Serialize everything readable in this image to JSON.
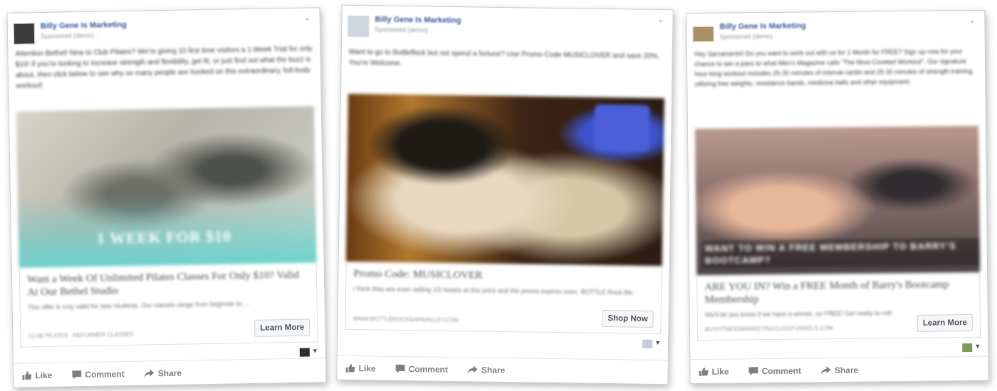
{
  "posts": [
    {
      "page_name": "Billy Gene Is Marketing",
      "sponsored": "Sponsored (demo) · ",
      "text": "Attention Bethel! New to Club Pilates? We're giving 10 first time visitors a 1-Week Trial for only $10! If you're looking to increase strength and flexibility, get fit, or just find out what the buzz is about, then click below to see why so many people are hooked on this extraordinary, full-body workout!",
      "image_overlay": "1 WEEK FOR $10",
      "headline": "Want a Week Of Unlimited Pilates Classes For Only $10? Valid At Our Bethel Studio",
      "description": "This offer is only valid for new students. Our classes range from beginner to ...",
      "url": "CLUB PILATES · REFORMER CLASSES",
      "cta": "Learn More"
    },
    {
      "page_name": "Billy Gene Is Marketing",
      "sponsored": "Sponsored (demo) · ",
      "text": "Want to go to Bottleflock but not spend a fortune? Use Promo Code MUSICLOVER and save 20%. You're Welcome.",
      "image_overlay": "",
      "headline": "Promo Code: MUSICLOVER",
      "description": "I think they are even selling 1/2 tickets at this price and the promo expires soon. BOTTLE Rock life.",
      "url": "WWW.BOTTLEROCKNAPAVALLEY.COM",
      "cta": "Shop Now"
    },
    {
      "page_name": "Billy Gene Is Marketing",
      "sponsored": "Sponsored (demo) · ",
      "text": "Hey Sacramento! Do you want to work out with us for 1 Month for FREE? Sign up now for your chance to win a pass to what Men's Magazine calls \"The Most Coveted Workout\". Our signature hour-long workout includes 25-30 minutes of interval cardio and 25-30 minutes of strength training, utilizing free weights, resistance bands, medicine balls and other equipment.",
      "image_overlay": "WANT TO WIN A FREE MEMBERSHIP TO BARRY'S BOOTCAMP?",
      "headline": "ARE YOU IN? Win a FREE Month of Barry's Bootcamp Membership",
      "description": "We'll let you know if we have a winner, so FREE! Get ready to roll!",
      "url": "BUYFITNESSMARKETINGCLICKFUNNELS.COM",
      "cta": "Learn More"
    }
  ],
  "actions": {
    "like": "Like",
    "comment": "Comment",
    "share": "Share"
  },
  "colors": {
    "page_name": "#365899",
    "action_text": "#7f7f7f",
    "button_bg": "#f6f7f9"
  },
  "icons": [
    "thumbs-up-icon",
    "comment-icon",
    "share-icon",
    "chevron-down-icon",
    "caret-down-icon"
  ]
}
